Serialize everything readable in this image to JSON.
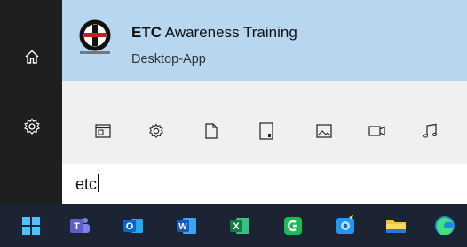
{
  "rail": {
    "items": [
      {
        "name": "home-icon"
      },
      {
        "name": "settings-icon"
      }
    ]
  },
  "best_match": {
    "title_bold": "ETC",
    "title_rest": " Awareness Training",
    "subtitle": "Desktop-App"
  },
  "filters": [
    {
      "name": "app-filter-icon"
    },
    {
      "name": "settings-filter-icon"
    },
    {
      "name": "document-filter-icon"
    },
    {
      "name": "folder-filter-icon"
    },
    {
      "name": "photo-filter-icon"
    },
    {
      "name": "video-filter-icon"
    },
    {
      "name": "music-filter-icon"
    }
  ],
  "search": {
    "value": "etc"
  },
  "taskbar": {
    "items": [
      {
        "name": "start-icon",
        "color": "#4cc2ff"
      },
      {
        "name": "teams-icon",
        "color": "#5b5fc7"
      },
      {
        "name": "outlook-icon",
        "color": "#0a64c8"
      },
      {
        "name": "word-icon",
        "color": "#2b6cd2"
      },
      {
        "name": "excel-icon",
        "color": "#1f8a4c"
      },
      {
        "name": "app-green-icon",
        "color": "#1db954"
      },
      {
        "name": "app-blue-icon",
        "color": "#2196f3"
      },
      {
        "name": "file-explorer-icon",
        "color": "#f5c242"
      },
      {
        "name": "edge-icon",
        "color": "#1e88e5"
      }
    ]
  }
}
